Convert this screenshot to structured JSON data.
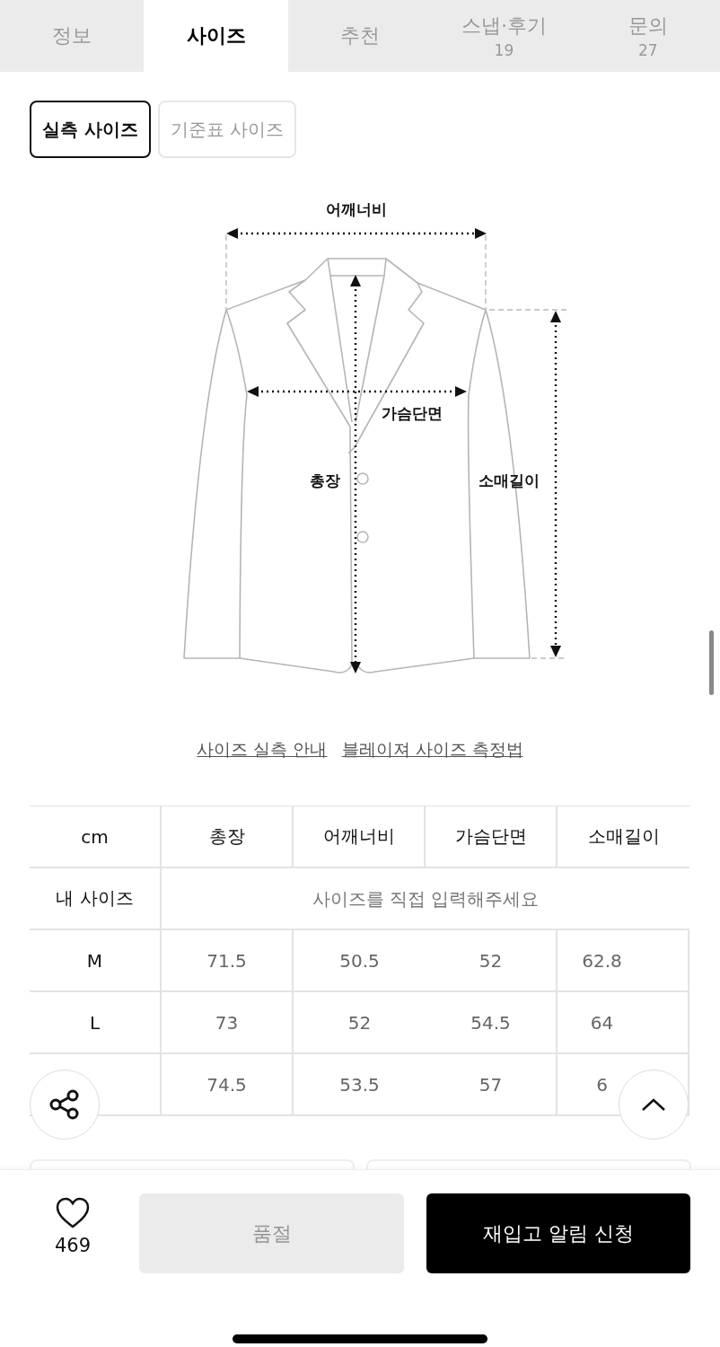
{
  "tabs": [
    {
      "label": "정보",
      "selected": false
    },
    {
      "label": "사이즈",
      "selected": true
    },
    {
      "label": "추천",
      "selected": false
    },
    {
      "label": "스냅·후기",
      "count": "19",
      "selected": false
    },
    {
      "label": "문의",
      "count": "27",
      "selected": false
    }
  ],
  "size_toggle": [
    {
      "label": "실측 사이즈",
      "selected": true
    },
    {
      "label": "기준표 사이즈",
      "selected": false
    }
  ],
  "diagram": {
    "measurements": [
      {
        "kind": "shoulder",
        "label": "어깨너비"
      },
      {
        "kind": "chest",
        "label": "가슴단면"
      },
      {
        "kind": "length",
        "label": "총장"
      },
      {
        "kind": "sleeve",
        "label": "소매길이"
      }
    ]
  },
  "guide_links": [
    "사이즈 실측 안내",
    "블레이져 사이즈 측정법"
  ],
  "size_table": {
    "columns": [
      "cm",
      "총장",
      "어깨너비",
      "가슴단면",
      "소매길이"
    ],
    "my_size": {
      "label": "내 사이즈",
      "placeholder": "사이즈를 직접 입력해주세요"
    },
    "rows": [
      {
        "size": "M",
        "values": [
          "71.5",
          "50.5",
          "52",
          "62.8"
        ]
      },
      {
        "size": "L",
        "values": [
          "73",
          "52",
          "54.5",
          "64"
        ]
      },
      {
        "values": [
          "74.5",
          "53.5",
          "57",
          "6"
        ]
      }
    ]
  },
  "like_count": "469",
  "sold_out_button": {
    "label": "품절",
    "disabled": true
  },
  "restock_button": "재입고 알림 신청"
}
